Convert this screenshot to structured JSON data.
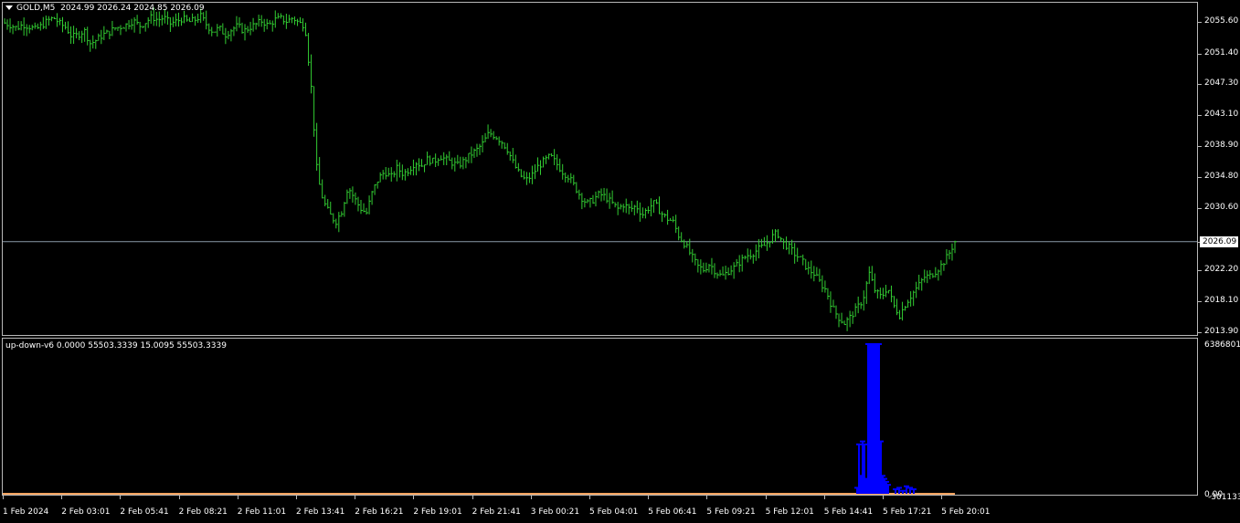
{
  "header": {
    "symbol": "GOLD,M5",
    "ohlc": "2024.99 2026.24 2024.85 2026.09"
  },
  "indicator": {
    "label": "up-down-v6 0.0000 55503.3339 15.0095 55503.3339",
    "scale_top": "6386801.2",
    "scale_zero": "0.00",
    "scale_bottom": "-301133.3"
  },
  "colors": {
    "candles": "#32cd32",
    "histogram": "#0000ff",
    "baseline": "#f4a460",
    "price_line": "#8a9aa8",
    "grid_border": "#b8b8b8"
  },
  "price_axis": {
    "labels": [
      "2055.60",
      "2051.40",
      "2047.30",
      "2043.10",
      "2038.90",
      "2034.80",
      "2030.60",
      "2026.09",
      "2022.20",
      "2018.10",
      "2013.90"
    ],
    "current_price": "2026.09"
  },
  "time_axis": {
    "labels": [
      "1 Feb 2024",
      "2 Feb 03:01",
      "2 Feb 05:41",
      "2 Feb 08:21",
      "2 Feb 11:01",
      "2 Feb 13:41",
      "2 Feb 16:21",
      "2 Feb 19:01",
      "2 Feb 21:41",
      "3 Feb 00:21",
      "5 Feb 04:01",
      "5 Feb 06:41",
      "5 Feb 09:21",
      "5 Feb 12:01",
      "5 Feb 14:41",
      "5 Feb 17:21",
      "5 Feb 20:01"
    ]
  },
  "chart_data": {
    "type": "line",
    "title": "GOLD,M5",
    "ylim": [
      2013.9,
      2057.6
    ],
    "close_series": [
      2055.5,
      2055.2,
      2054.8,
      2055.3,
      2055.0,
      2054.6,
      2055.1,
      2055.8,
      2056.2,
      2055.4,
      2054.9,
      2053.6,
      2053.9,
      2054.5,
      2052.7,
      2053.2,
      2053.9,
      2054.2,
      2054.8,
      2055.0,
      2055.3,
      2055.8,
      2055.1,
      2055.6,
      2056.3,
      2055.9,
      2056.2,
      2055.4,
      2055.7,
      2056.1,
      2055.6,
      2055.9,
      2056.4,
      2055.2,
      2054.3,
      2054.8,
      2053.9,
      2054.6,
      2055.1,
      2054.4,
      2054.9,
      2055.3,
      2055.8,
      2055.1,
      2055.9,
      2056.1,
      2055.7,
      2056.2,
      2055.5,
      2055.2,
      2047.0,
      2035.0,
      2031.5,
      2029.8,
      2028.7,
      2030.2,
      2033.5,
      2032.0,
      2030.6,
      2029.9,
      2032.8,
      2034.6,
      2035.5,
      2034.7,
      2036.0,
      2035.2,
      2035.8,
      2036.8,
      2036.3,
      2037.2,
      2036.8,
      2037.6,
      2037.1,
      2036.7,
      2036.3,
      2037.0,
      2037.8,
      2038.4,
      2039.3,
      2040.7,
      2040.3,
      2039.6,
      2038.5,
      2036.6,
      2035.1,
      2034.3,
      2035.0,
      2036.2,
      2036.9,
      2037.6,
      2036.6,
      2035.5,
      2034.8,
      2033.5,
      2032.1,
      2031.2,
      2031.7,
      2032.5,
      2032.1,
      2031.3,
      2030.5,
      2031.1,
      2030.4,
      2030.9,
      2029.7,
      2030.6,
      2031.3,
      2030.0,
      2029.2,
      2028.8,
      2026.8,
      2025.7,
      2024.2,
      2022.8,
      2022.3,
      2023.1,
      2022.0,
      2021.4,
      2022.1,
      2022.6,
      2023.4,
      2024.2,
      2024.5,
      2025.1,
      2025.6,
      2026.6,
      2027.3,
      2025.9,
      2025.3,
      2024.3,
      2023.6,
      2022.4,
      2021.8,
      2020.6,
      2019.5,
      2017.2,
      2015.9,
      2015.1,
      2016.0,
      2017.1,
      2018.3,
      2021.9,
      2019.4,
      2018.6,
      2020.0,
      2017.5,
      2016.2,
      2017.8,
      2019.0,
      2020.1,
      2021.3,
      2021.5,
      2022.2,
      2023.1,
      2024.4,
      2026.1
    ],
    "series": [
      {
        "name": "up-down-v6",
        "histogram_peak": 6386801.2
      }
    ]
  }
}
